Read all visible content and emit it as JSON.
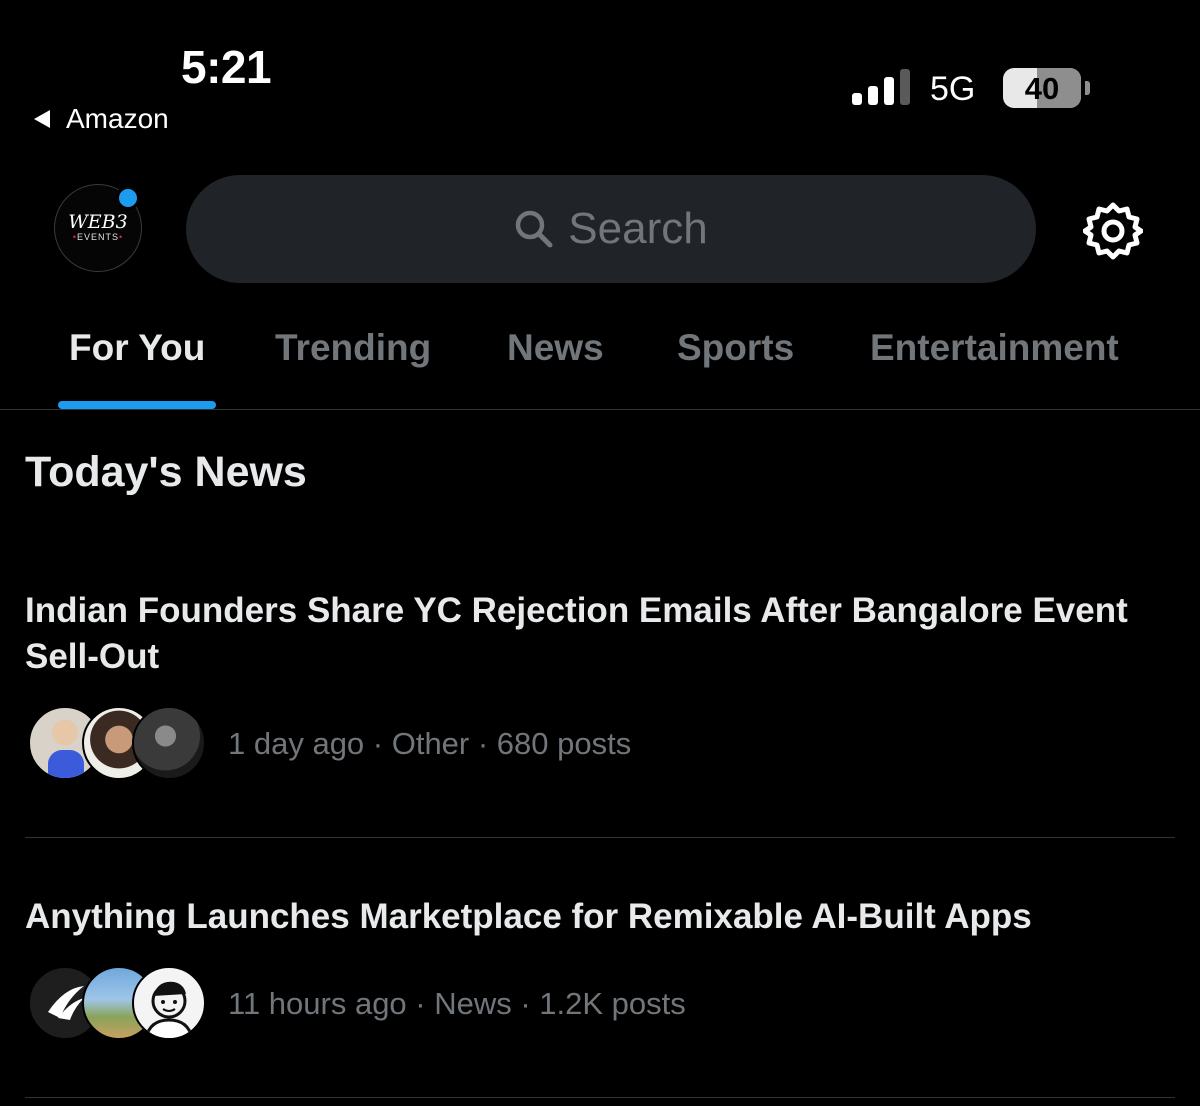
{
  "status_bar": {
    "time": "5:21",
    "back_app": "Amazon",
    "network": "5G",
    "battery": "40"
  },
  "header": {
    "avatar_line1": "WEB3",
    "avatar_line2": "EVENTS",
    "search_placeholder": "Search"
  },
  "tabs": [
    {
      "label": "For You",
      "active": true
    },
    {
      "label": "Trending",
      "active": false
    },
    {
      "label": "News",
      "active": false
    },
    {
      "label": "Sports",
      "active": false
    },
    {
      "label": "Entertainment",
      "active": false
    }
  ],
  "section_title": "Today's News",
  "news": [
    {
      "title": "Indian Founders Share YC Rejection Emails After Bangalore Event Sell-Out",
      "meta": "1 day ago · Other · 680 posts"
    },
    {
      "title": "Anything Launches Marketplace for Remixable AI-Built Apps",
      "meta": "11 hours ago · News · 1.2K posts"
    }
  ],
  "colors": {
    "accent": "#1d9bf0",
    "background": "#000000",
    "muted_text": "#71767b",
    "primary_text": "#e7e9ea"
  }
}
